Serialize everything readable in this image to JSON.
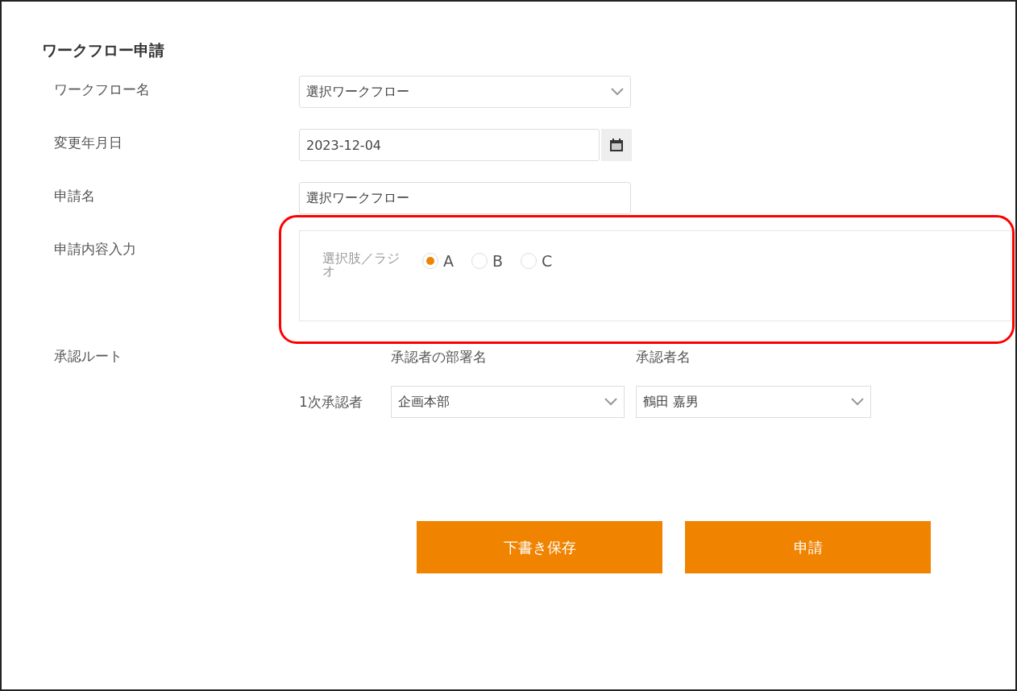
{
  "title": "ワークフロー申請",
  "fields": [
    {
      "kind": "select",
      "label": "ワークフロー名",
      "value": "選択ワークフロー"
    },
    {
      "kind": "date",
      "label": "変更年月日",
      "value": "2023-12-04"
    },
    {
      "kind": "text",
      "label": "申請名",
      "value": "選択ワークフロー"
    }
  ],
  "content_input": {
    "label": "申請内容入力",
    "highlighted": true,
    "radio_label": "選択肢／ラジオ",
    "options": [
      {
        "label": "A",
        "selected": true
      },
      {
        "label": "B",
        "selected": false
      },
      {
        "label": "C",
        "selected": false
      }
    ]
  },
  "approval_route": {
    "label": "承認ルート",
    "column_headers": [
      "承認者の部署名",
      "承認者名"
    ],
    "rows": [
      {
        "label": "1次承認者",
        "department": "企画本部",
        "approver": "鶴田 嘉男"
      }
    ]
  },
  "buttons": [
    "下書き保存",
    "申請"
  ]
}
